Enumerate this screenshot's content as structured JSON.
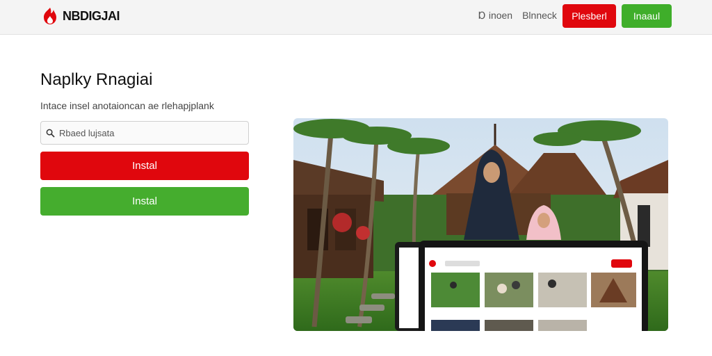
{
  "header": {
    "brand": "NBDIGJAI",
    "nav": [
      "Ɒ inoen",
      "Blnneck"
    ],
    "btn_red": "Plesberl",
    "btn_green": "Inaaul"
  },
  "hero": {
    "title": "Naplky Rnagiai",
    "subtitle": "Intace insel anotaioncan ae rlehapjplank",
    "search_placeholder": "Rbaed lujsata",
    "install_red": "Instal",
    "install_green": "Instal"
  },
  "colors": {
    "brand_red": "#e0070d",
    "brand_green": "#45ad2e"
  },
  "icons": [
    "flame-logo-icon",
    "search-icon"
  ]
}
